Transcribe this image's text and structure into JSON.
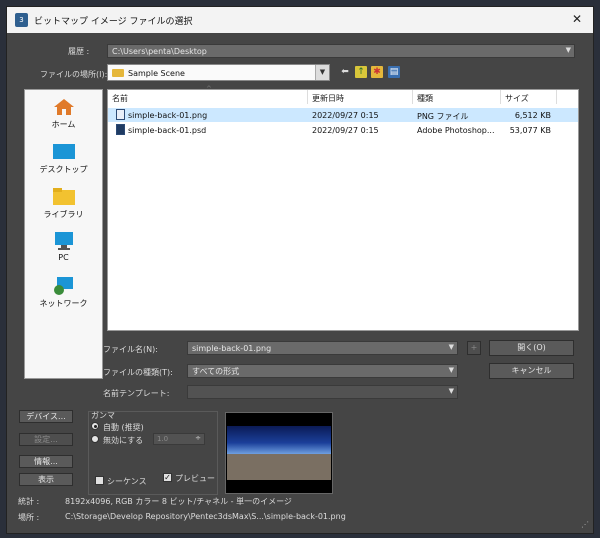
{
  "window": {
    "title": "ビットマップ イメージ ファイルの選択",
    "close_glyph": "✕"
  },
  "history": {
    "label": "履歴 :",
    "value": "C:\\Users\\penta\\Desktop"
  },
  "look_in": {
    "label": "ファイルの場所(I):",
    "value": "Sample Scene"
  },
  "places": [
    {
      "label": "ホーム"
    },
    {
      "label": "デスクトップ"
    },
    {
      "label": "ライブラリ"
    },
    {
      "label": "PC"
    },
    {
      "label": "ネットワーク"
    }
  ],
  "columns": {
    "name": "名前",
    "modified": "更新日時",
    "type": "種類",
    "size": "サイズ"
  },
  "files": [
    {
      "name": "simple-back-01.png",
      "modified": "2022/09/27 0:15",
      "type": "PNG ファイル",
      "size": "6,512 KB",
      "selected": true
    },
    {
      "name": "simple-back-01.psd",
      "modified": "2022/09/27 0:15",
      "type": "Adobe Photoshop...",
      "size": "53,077 KB",
      "selected": false
    }
  ],
  "filename": {
    "label": "ファイル名(N):",
    "value": "simple-back-01.png",
    "plus": "+"
  },
  "filetype": {
    "label": "ファイルの種類(T):",
    "value": "すべての形式"
  },
  "template": {
    "label": "名前テンプレート:",
    "value": ""
  },
  "buttons": {
    "open": "開く(O)",
    "cancel": "キャンセル",
    "devices": "デバイス...",
    "settings": "設定...",
    "info": "情報...",
    "view": "表示"
  },
  "gamma": {
    "title": "ガンマ",
    "auto": "自動 (推奨)",
    "override": "無効にする",
    "override_value": "1.0"
  },
  "options": {
    "sequence": "シーケンス",
    "preview": "プレビュー",
    "preview_checked": true
  },
  "stats": {
    "label": "統計 :",
    "value": "8192x4096, RGB カラー 8 ビット/チャネル - 単一のイメージ"
  },
  "location": {
    "label": "場所 :",
    "value": "C:\\Storage\\Develop Repository\\Pentec3dsMax\\S...\\simple-back-01.png"
  },
  "colors": {
    "dialog_bg": "#454545",
    "selection": "#cce8ff",
    "preview_sky_top": "#1b3f9a",
    "preview_band": "#6f9fe0",
    "preview_ground": "#7a6f62"
  }
}
